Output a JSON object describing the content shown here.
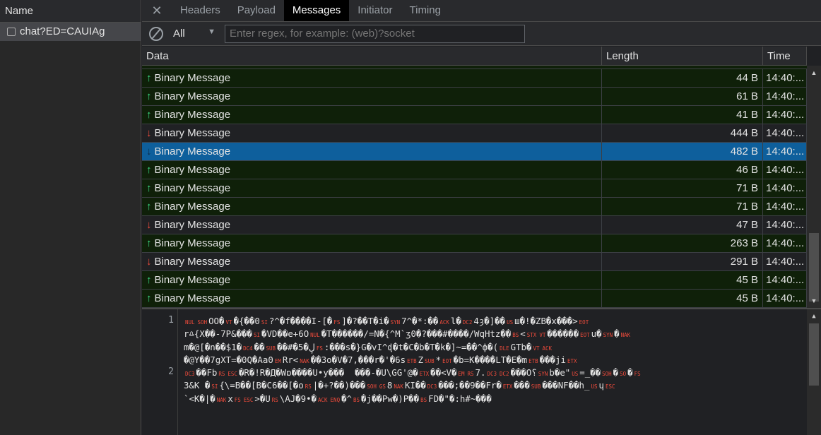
{
  "left_panel": {
    "header": "Name",
    "items": [
      {
        "label": "chat?ED=CAUIAg"
      }
    ]
  },
  "tabs": {
    "close_icon": "close-icon",
    "items": [
      "Headers",
      "Payload",
      "Messages",
      "Initiator",
      "Timing"
    ],
    "active": "Messages"
  },
  "filter": {
    "type_value": "All",
    "regex_placeholder": "Enter regex, for example: (web)?socket"
  },
  "table": {
    "columns": [
      "Data",
      "Length",
      "Time"
    ],
    "rows": [
      {
        "dir": "up",
        "data": "Binary Message",
        "length": "44 B",
        "time": "14:40:..."
      },
      {
        "dir": "up",
        "data": "Binary Message",
        "length": "61 B",
        "time": "14:40:..."
      },
      {
        "dir": "up",
        "data": "Binary Message",
        "length": "41 B",
        "time": "14:40:..."
      },
      {
        "dir": "down",
        "data": "Binary Message",
        "length": "444 B",
        "time": "14:40:..."
      },
      {
        "dir": "down",
        "data": "Binary Message",
        "length": "482 B",
        "time": "14:40:...",
        "selected": true
      },
      {
        "dir": "up",
        "data": "Binary Message",
        "length": "46 B",
        "time": "14:40:..."
      },
      {
        "dir": "up",
        "data": "Binary Message",
        "length": "71 B",
        "time": "14:40:..."
      },
      {
        "dir": "up",
        "data": "Binary Message",
        "length": "71 B",
        "time": "14:40:..."
      },
      {
        "dir": "down",
        "data": "Binary Message",
        "length": "47 B",
        "time": "14:40:..."
      },
      {
        "dir": "up",
        "data": "Binary Message",
        "length": "263 B",
        "time": "14:40:..."
      },
      {
        "dir": "down",
        "data": "Binary Message",
        "length": "291 B",
        "time": "14:40:..."
      },
      {
        "dir": "up",
        "data": "Binary Message",
        "length": "45 B",
        "time": "14:40:..."
      },
      {
        "dir": "up",
        "data": "Binary Message",
        "length": "45 B",
        "time": "14:40:..."
      }
    ]
  },
  "colors": {
    "up_arrow": "#3ddc84",
    "down_arrow": "#ee4b3b",
    "selected_row": "#0e5f9c",
    "sent_row": "#0f2009"
  },
  "viewer": {
    "line_numbers": [
      {
        "n": "1",
        "row": 0
      },
      {
        "n": "2",
        "row": 4
      }
    ],
    "lines": [
      [
        {
          "c": "NUL"
        },
        {
          "c": "SOH"
        },
        {
          "t": "OO�"
        },
        {
          "c": "VT"
        },
        {
          "t": "�{��0"
        },
        {
          "c": "SI"
        },
        {
          "t": "?^�f����I-[�"
        },
        {
          "c": "FS"
        },
        {
          "t": "]�?��T�i�"
        },
        {
          "c": "SYN"
        },
        {
          "t": "7^�*:��"
        },
        {
          "c": "ACK"
        },
        {
          "t": "l�"
        },
        {
          "c": "DC2"
        },
        {
          "t": "4ȝ�]��"
        },
        {
          "c": "US"
        },
        {
          "t": "ш�!�ZB�x���>"
        },
        {
          "c": "EOT"
        }
      ],
      [
        {
          "t": "r♎{X��-7P&���"
        },
        {
          "c": "SI"
        },
        {
          "t": "�VD��e+6O"
        },
        {
          "c": "NUL"
        },
        {
          "t": "�T������/=N�{^M`ʒ0�?���#����/WqHtz��"
        },
        {
          "c": "BS"
        },
        {
          "t": "<"
        },
        {
          "c": "STX"
        },
        {
          "c": "VT"
        },
        {
          "t": "������"
        },
        {
          "c": "EOT"
        },
        {
          "t": "u�"
        },
        {
          "c": "SYN"
        },
        {
          "t": "�"
        },
        {
          "c": "NAK"
        }
      ],
      [
        {
          "t": "m�@[�n��$1�"
        },
        {
          "c": "DC4"
        },
        {
          "t": "��"
        },
        {
          "c": "SUB"
        },
        {
          "t": "��#�5�ڸ"
        },
        {
          "c": "FS"
        },
        {
          "t": ":���s�}G�vI^ɖ�t�C�b�T�k�]~=��^ф�("
        },
        {
          "c": "DLE"
        },
        {
          "t": "GTb�"
        },
        {
          "c": "VT"
        },
        {
          "c": "ACK"
        }
      ],
      [
        {
          "t": "�@Y��7gXT=�0Q�Aa0"
        },
        {
          "c": "EM"
        },
        {
          "t": "Rr<"
        },
        {
          "c": "NAK"
        },
        {
          "t": "��3o�V�7,���r�'�6s"
        },
        {
          "c": "ETB"
        },
        {
          "t": "Z"
        },
        {
          "c": "SUB"
        },
        {
          "t": "*"
        },
        {
          "c": "EOT"
        },
        {
          "t": "�b=K����LT�E�m"
        },
        {
          "c": "ETB"
        },
        {
          "t": "���ji"
        },
        {
          "c": "ETX"
        }
      ],
      [
        {
          "c": "DC3"
        },
        {
          "t": "��Fb"
        },
        {
          "c": "RS"
        },
        {
          "c": "ESC"
        },
        {
          "t": "�R�!R�Д�Wɒ����U•y���  ���-�U\\GG'@�"
        },
        {
          "c": "ETX"
        },
        {
          "t": "��<V�"
        },
        {
          "c": "EM"
        },
        {
          "c": "RS"
        },
        {
          "t": "7."
        },
        {
          "c": "DC3"
        },
        {
          "c": "DC2"
        },
        {
          "t": "���O؟"
        },
        {
          "c": "SYN"
        },
        {
          "t": "b�e\""
        },
        {
          "c": "US"
        },
        {
          "t": "=_��"
        },
        {
          "c": "SOH"
        },
        {
          "t": "�"
        },
        {
          "c": "SO"
        },
        {
          "t": "�"
        },
        {
          "c": "FS"
        }
      ],
      [
        {
          "t": "3&K �"
        },
        {
          "c": "SI"
        },
        {
          "t": "{\\=B��[B�C6��[�o"
        },
        {
          "c": "RS"
        },
        {
          "t": "|�+?��)���"
        },
        {
          "c": "SOH"
        },
        {
          "c": "GS"
        },
        {
          "t": "8"
        },
        {
          "c": "NAK"
        },
        {
          "t": "KI��"
        },
        {
          "c": "DC3"
        },
        {
          "t": "���;��9��Fr�"
        },
        {
          "c": "ETX"
        },
        {
          "t": "���"
        },
        {
          "c": "SUB"
        },
        {
          "t": "���NF��h_"
        },
        {
          "c": "US"
        },
        {
          "t": "ɥ"
        },
        {
          "c": "ESC"
        }
      ],
      [
        {
          "t": "`<K�|�"
        },
        {
          "c": "NAK"
        },
        {
          "t": "x"
        },
        {
          "c": "FS"
        },
        {
          "c": "ESC"
        },
        {
          "t": ">�U"
        },
        {
          "c": "RS"
        },
        {
          "t": "\\AJ�9•�"
        },
        {
          "c": "ACK"
        },
        {
          "c": "ENQ"
        },
        {
          "t": "�^"
        },
        {
          "c": "BS"
        },
        {
          "t": "�j��Pw�)P��"
        },
        {
          "c": "BS"
        },
        {
          "t": "FD�\"�:h#~���"
        }
      ]
    ]
  }
}
